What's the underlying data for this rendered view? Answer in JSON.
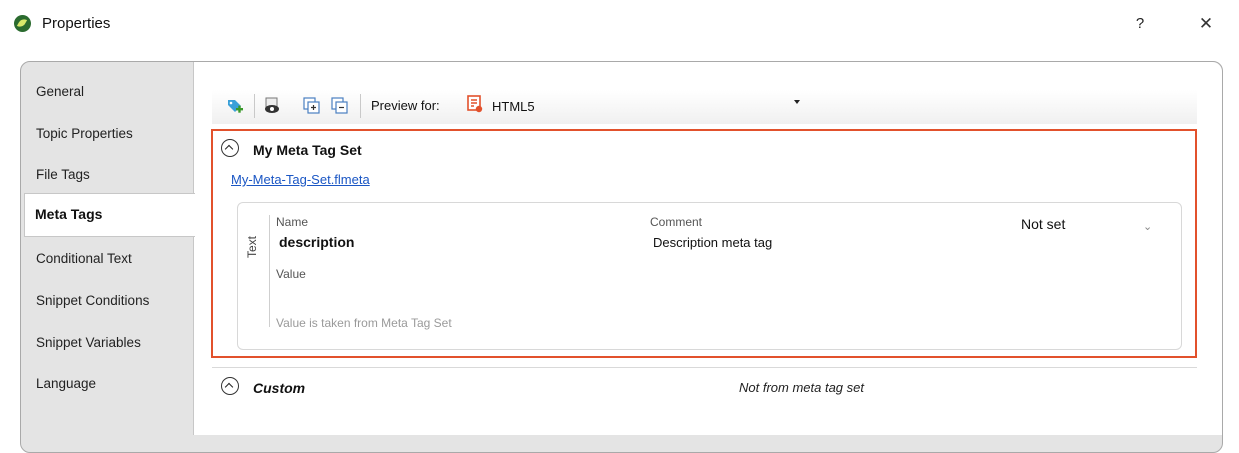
{
  "window": {
    "title": "Properties",
    "help_label": "?",
    "close_label": "✕"
  },
  "sidebar": {
    "items": [
      {
        "label": "General"
      },
      {
        "label": "Topic Properties"
      },
      {
        "label": "File Tags"
      },
      {
        "label": "Meta Tags"
      },
      {
        "label": "Conditional Text"
      },
      {
        "label": "Snippet Conditions"
      },
      {
        "label": "Snippet Variables"
      },
      {
        "label": "Language"
      }
    ],
    "active": "Meta Tags"
  },
  "toolbar": {
    "preview_label": "Preview for:",
    "preview_target": "HTML5",
    "icons": [
      "add-tag-icon",
      "preview-eye-icon",
      "expand-all-icon",
      "collapse-all-icon",
      "html5-target-icon"
    ]
  },
  "meta_set": {
    "title": "My Meta Tag Set",
    "link": "My-Meta-Tag-Set.flmeta",
    "tag": {
      "group_label": "Text",
      "name_label": "Name",
      "name_value": "description",
      "comment_label": "Comment",
      "comment_value": "Description meta tag",
      "status_value": "Not set",
      "value_label": "Value",
      "value_hint": "Value is taken from Meta Tag Set"
    }
  },
  "custom": {
    "title": "Custom",
    "note": "Not from meta tag set"
  },
  "colors": {
    "highlight_border": "#e2512c",
    "link": "#1a56c4"
  }
}
